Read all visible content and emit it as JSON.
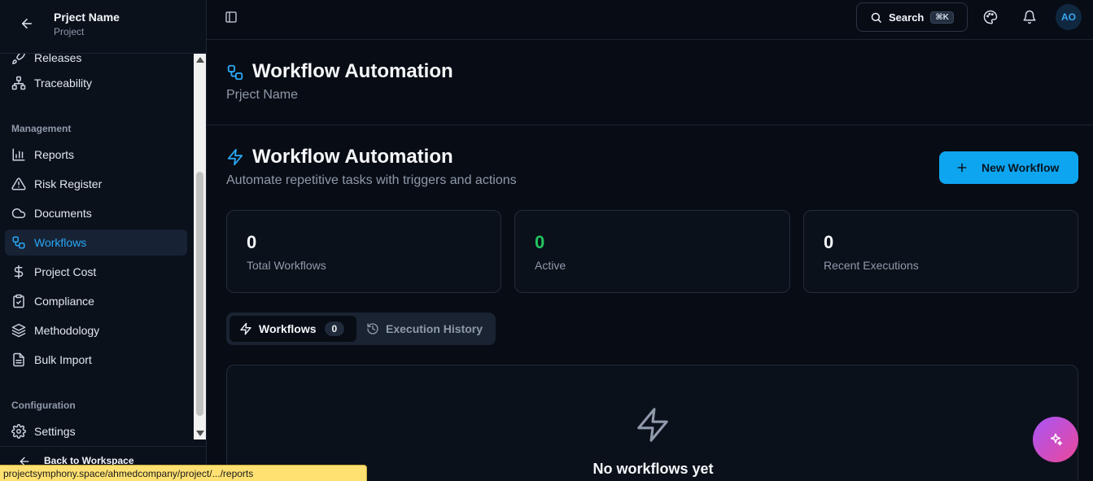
{
  "sidebar": {
    "project_name": "Prject Name",
    "project_type": "Project",
    "nav_top": [
      {
        "label": "Releases",
        "icon": "rocket-icon"
      },
      {
        "label": "Traceability",
        "icon": "network-icon"
      }
    ],
    "management_label": "Management",
    "management": [
      {
        "label": "Reports",
        "icon": "bar-chart-icon"
      },
      {
        "label": "Risk Register",
        "icon": "alert-triangle-icon"
      },
      {
        "label": "Documents",
        "icon": "cloud-icon"
      },
      {
        "label": "Workflows",
        "icon": "workflow-icon",
        "active": true
      },
      {
        "label": "Project Cost",
        "icon": "dollar-icon"
      },
      {
        "label": "Compliance",
        "icon": "clipboard-check-icon"
      },
      {
        "label": "Methodology",
        "icon": "layers-icon"
      },
      {
        "label": "Bulk Import",
        "icon": "file-text-icon"
      }
    ],
    "configuration_label": "Configuration",
    "configuration": [
      {
        "label": "Settings",
        "icon": "gear-icon"
      }
    ],
    "back_to_workspace": "Back to Workspace"
  },
  "topbar": {
    "search_label": "Search",
    "search_shortcut": "⌘K",
    "avatar_initials": "AO"
  },
  "page_header": {
    "title": "Workflow Automation",
    "subtitle": "Prject Name"
  },
  "main": {
    "title": "Workflow Automation",
    "subtitle": "Automate repetitive tasks with triggers and actions",
    "new_button": "New Workflow",
    "stats": [
      {
        "value": "0",
        "label": "Total Workflows",
        "color": "#f5f7fa"
      },
      {
        "value": "0",
        "label": "Active",
        "color": "#22c55e"
      },
      {
        "value": "0",
        "label": "Recent Executions",
        "color": "#f5f7fa"
      }
    ],
    "tabs": {
      "workflows_label": "Workflows",
      "workflows_count": "0",
      "history_label": "Execution History"
    },
    "empty_title": "No workflows yet"
  },
  "status_bar": {
    "url": "projectsymphony.space/ahmedcompany/project/.../reports"
  },
  "colors": {
    "accent": "#2aa7f4",
    "primary_button": "#0ea5f0",
    "active_green": "#22c55e",
    "background": "#080c14"
  }
}
